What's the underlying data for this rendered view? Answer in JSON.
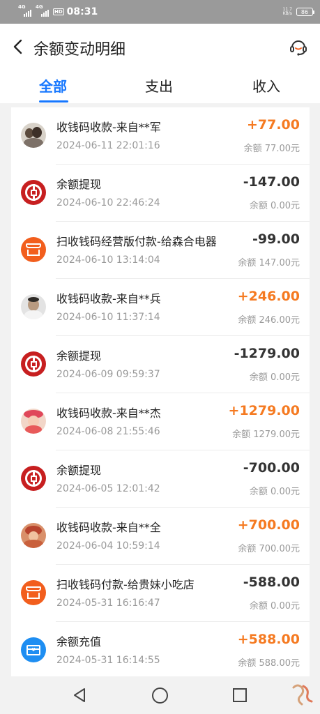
{
  "status_bar": {
    "signal1": "4G",
    "signal2": "4G",
    "hd": "HD",
    "time": "08:31",
    "net_speed": "11.7",
    "net_unit": "KB/s",
    "battery": "86"
  },
  "header": {
    "title": "余额变动明细"
  },
  "tabs": [
    {
      "label": "全部",
      "active": true
    },
    {
      "label": "支出",
      "active": false
    },
    {
      "label": "收入",
      "active": false
    }
  ],
  "transactions": [
    {
      "icon": "avatar-photo",
      "title": "收钱码收款-来自**军",
      "time": "2024-06-11 22:01:16",
      "amount": "+77.00",
      "balance": "余额 77.00元"
    },
    {
      "icon": "bank-icon",
      "title": "余额提现",
      "time": "2024-06-10 22:46:24",
      "amount": "-147.00",
      "balance": "余额 0.00元"
    },
    {
      "icon": "shop-icon",
      "title": "扫收钱码经营版付款-给森合电器",
      "time": "2024-06-10 13:14:04",
      "amount": "-99.00",
      "balance": "余额 147.00元"
    },
    {
      "icon": "avatar-photo",
      "title": "收钱码收款-来自**兵",
      "time": "2024-06-10 11:37:14",
      "amount": "+246.00",
      "balance": "余额 246.00元"
    },
    {
      "icon": "bank-icon",
      "title": "余额提现",
      "time": "2024-06-09 09:59:37",
      "amount": "-1279.00",
      "balance": "余额 0.00元"
    },
    {
      "icon": "avatar-photo",
      "title": "收钱码收款-来自**杰",
      "time": "2024-06-08 21:55:46",
      "amount": "+1279.00",
      "balance": "余额 1279.00元"
    },
    {
      "icon": "bank-icon",
      "title": "余额提现",
      "time": "2024-06-05 12:01:42",
      "amount": "-700.00",
      "balance": "余额 0.00元"
    },
    {
      "icon": "avatar-photo",
      "title": "收钱码收款-来自**全",
      "time": "2024-06-04 10:59:14",
      "amount": "+700.00",
      "balance": "余额 700.00元"
    },
    {
      "icon": "shop-icon",
      "title": "扫收钱码付款-给贵妹小吃店",
      "time": "2024-05-31 16:16:47",
      "amount": "-588.00",
      "balance": "余额 0.00元"
    },
    {
      "icon": "topup-icon",
      "title": "余额充值",
      "time": "2024-05-31 16:14:55",
      "amount": "+588.00",
      "balance": "余额 588.00元"
    }
  ],
  "colors": {
    "accent": "#1677ff",
    "income": "#f57a21",
    "bank": "#c71f20",
    "shop": "#f25e1d",
    "topup": "#1e8ef2"
  }
}
